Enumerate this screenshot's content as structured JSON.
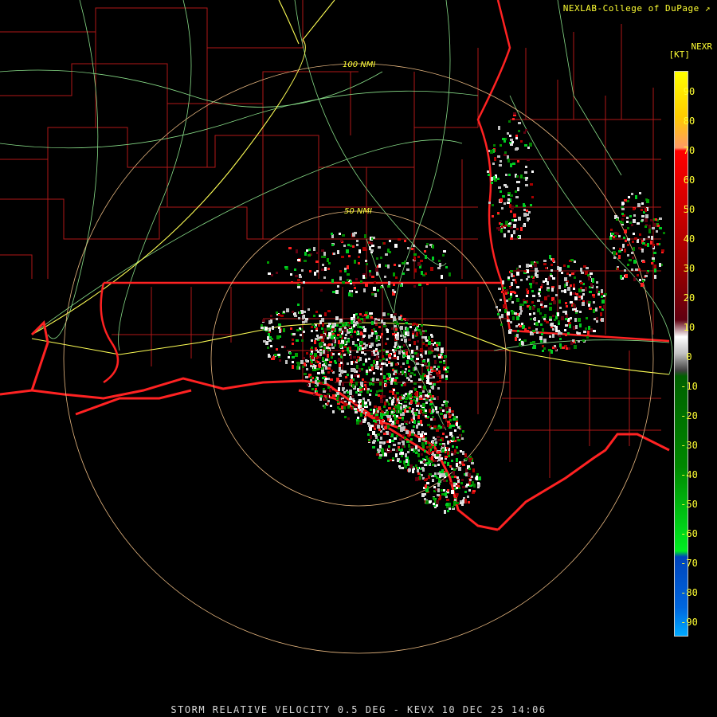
{
  "header": {
    "credit": "NEXLAB-College of DuPage",
    "credit_icon": "dish-icon",
    "product_code": "NEXR",
    "units": "[KT]"
  },
  "rings": {
    "ring_inner_label": "50 NMI",
    "ring_outer_label": "100 NMI"
  },
  "legend": {
    "ticks": [
      "90",
      "80",
      "70",
      "60",
      "50",
      "40",
      "30",
      "20",
      "10",
      "0",
      "-10",
      "-20",
      "-30",
      "-40",
      "-50",
      "-60",
      "-70",
      "-80",
      "-90"
    ],
    "colors": {
      "yellow": "#ffff00",
      "orange": "#ff9966",
      "red": "#ff0000",
      "dark_red": "#600010",
      "gray": "#c0c0c0",
      "dark_green": "#006000",
      "green": "#00ee22",
      "blue": "#0044bb",
      "light_blue": "#00aaff"
    }
  },
  "caption": "STORM RELATIVE VELOCITY 0.5 DEG - KEVX 10 DEC 25 14:06",
  "map_colors": {
    "state_lines": "#ff2222",
    "county_lines": "#b01818",
    "highways": "#88dd88",
    "interstates": "#ffff55",
    "range_rings": "#e8b880"
  }
}
